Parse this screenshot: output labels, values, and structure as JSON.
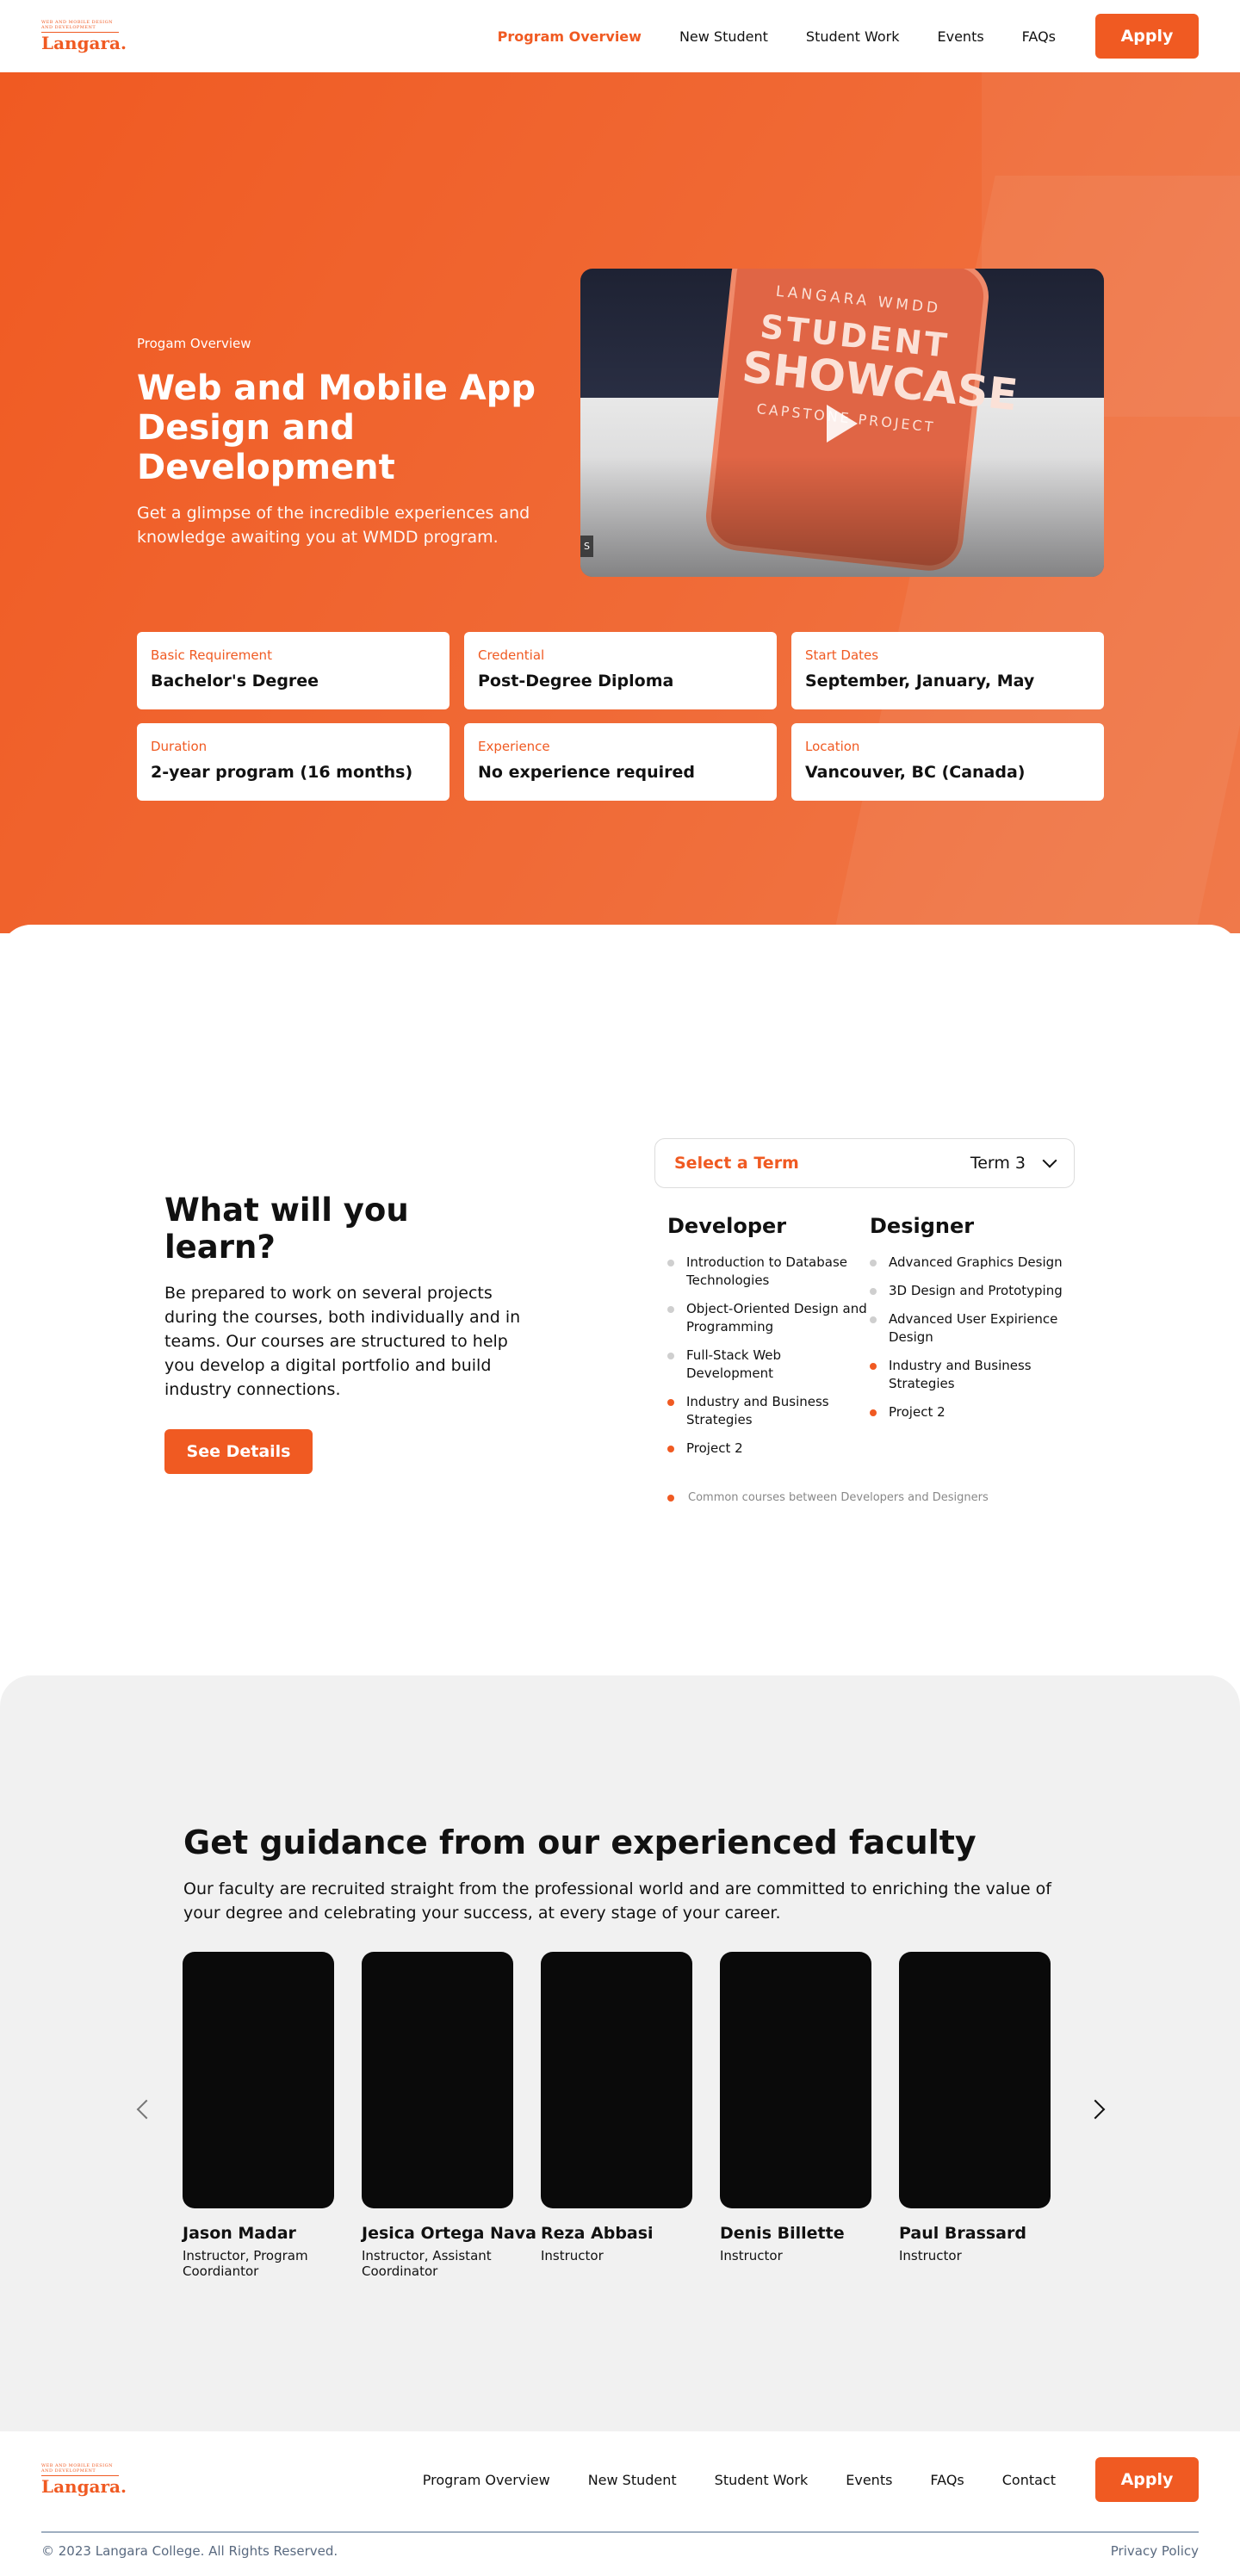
{
  "header": {
    "logo_small": "WEB AND MOBILE DESIGN AND DEVELOPMENT",
    "logo_main": "Langara.",
    "nav": [
      "Program Overview",
      "New Student",
      "Student Work",
      "Events",
      "FAQs"
    ],
    "apply": "Apply"
  },
  "hero": {
    "eyebrow": "Progam Overview",
    "title": "Web and Mobile App Design and Development",
    "subtitle": "Get a glimpse of the incredible experiences and knowledge awaiting you at WMDD program.",
    "video": {
      "badge_top": "LANGARA WMDD",
      "badge_mid1": "STUDENT",
      "badge_mid2": "SHOWCASE",
      "badge_bottom": "CAPSTONE PROJECT",
      "tag": "S"
    },
    "info": [
      {
        "label": "Basic Requirement",
        "value": "Bachelor's Degree"
      },
      {
        "label": "Credential",
        "value": "Post-Degree Diploma"
      },
      {
        "label": "Start Dates",
        "value": "September, January, May"
      },
      {
        "label": "Duration",
        "value": "2-year program (16 months)"
      },
      {
        "label": "Experience",
        "value": "No experience required"
      },
      {
        "label": "Location",
        "value": "Vancouver, BC (Canada)"
      }
    ]
  },
  "learn": {
    "title": "What will you learn?",
    "description": "Be prepared to work on several projects during the courses, both individually and in teams. Our courses are structured to help you develop a digital portfolio and build industry connections.",
    "button": "See Details",
    "term_label": "Select a Term",
    "term_value": "Term 3",
    "developer": {
      "title": "Developer",
      "courses": [
        {
          "name": "Introduction to Database Technologies",
          "common": false
        },
        {
          "name": "Object-Oriented Design and Programming",
          "common": false
        },
        {
          "name": "Full-Stack Web Development",
          "common": false
        },
        {
          "name": "Industry and Business Strategies",
          "common": true
        },
        {
          "name": "Project 2",
          "common": true
        }
      ]
    },
    "designer": {
      "title": "Designer",
      "courses": [
        {
          "name": "Advanced Graphics Design",
          "common": false
        },
        {
          "name": "3D Design and Prototyping",
          "common": false
        },
        {
          "name": "Advanced User Expirience Design",
          "common": false
        },
        {
          "name": "Industry and Business Strategies",
          "common": true
        },
        {
          "name": "Project 2",
          "common": true
        }
      ]
    },
    "legend": "Common courses between Developers and Designers"
  },
  "faculty": {
    "title": "Get guidance from our experienced faculty",
    "description": "Our faculty are recruited straight from the professional world and are committed to enriching the value of your degree and celebrating your success, at every stage of your career.",
    "members": [
      {
        "name": "Jason Madar",
        "role": "Instructor, Program Coordiantor"
      },
      {
        "name": "Jesica Ortega Nava",
        "role": "Instructor, Assistant Coordinator"
      },
      {
        "name": "Reza Abbasi",
        "role": "Instructor"
      },
      {
        "name": "Denis Billette",
        "role": "Instructor"
      },
      {
        "name": "Paul Brassard",
        "role": "Instructor"
      }
    ]
  },
  "footer": {
    "nav": [
      "Program Overview",
      "New Student",
      "Student Work",
      "Events",
      "FAQs",
      "Contact"
    ],
    "apply": "Apply",
    "copyright": "© 2023 Langara College. All Rights Reserved.",
    "privacy": "Privacy Policy"
  },
  "colors": {
    "accent": "#F05A22",
    "faculty_bg": "#F1F1F1"
  }
}
